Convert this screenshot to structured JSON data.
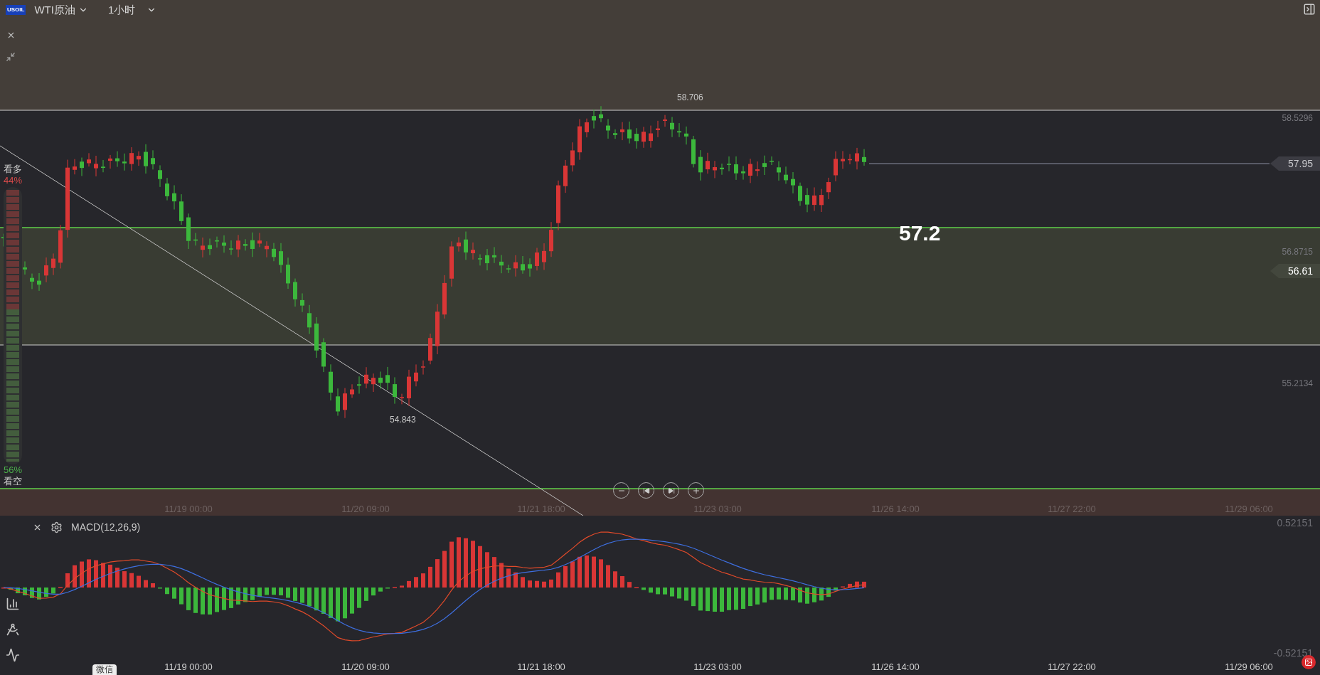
{
  "header": {
    "symbol_badge": "USOIL",
    "instrument": "WTI原油",
    "interval": "1小时"
  },
  "price_axis": [
    "58.5296",
    "56.8715",
    "55.2134"
  ],
  "price_tags": [
    {
      "text": "57.95",
      "kind": "last"
    },
    {
      "text": "56.61",
      "kind": "cursor"
    }
  ],
  "extremes": {
    "high": "58.706",
    "low": "54.843"
  },
  "zone_label": "57.2",
  "sentiment": {
    "bull_label": "看多",
    "bull_percent": "44%",
    "bear_percent": "56%",
    "bear_label": "看空",
    "level": 0.44
  },
  "time_axis": [
    "11/19 00:00",
    "11/20 09:00",
    "11/21 18:00",
    "11/23 03:00",
    "11/26 14:00",
    "11/27 22:00",
    "11/29 06:00"
  ],
  "indicator": {
    "name": "MACD(12,26,9)",
    "axis": [
      "0.52151",
      "-0.52151"
    ],
    "time_axis": [
      "11/19 00:00",
      "11/20 09:00",
      "11/21 18:00",
      "11/23 03:00",
      "11/26 14:00",
      "11/27 22:00",
      "11/29 06:00"
    ]
  },
  "tooltip": "微信"
}
